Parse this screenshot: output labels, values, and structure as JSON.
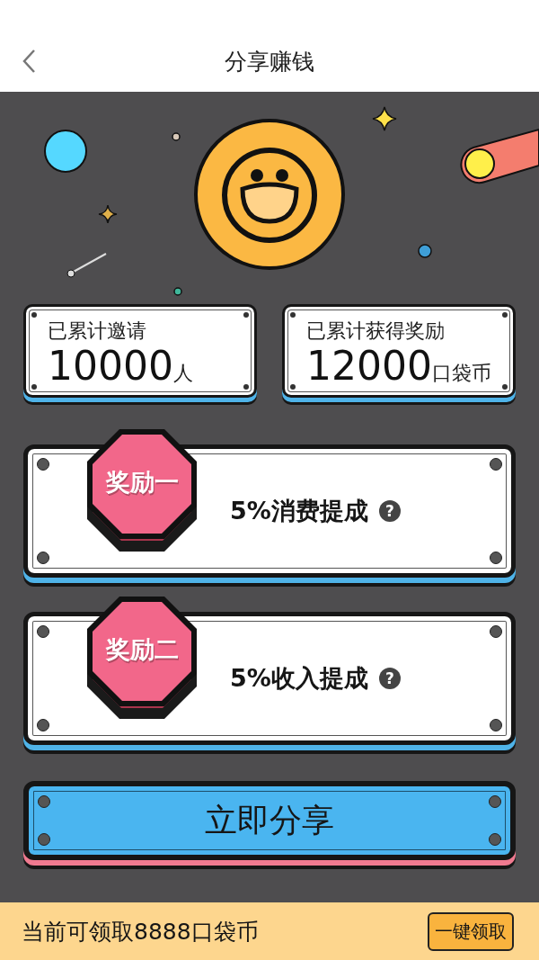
{
  "header": {
    "title": "分享赚钱"
  },
  "stats": [
    {
      "label": "已累计邀请",
      "value": "10000",
      "unit": "人"
    },
    {
      "label": "已累计获得奖励",
      "value": "12000",
      "unit": "口袋币"
    }
  ],
  "rewards": [
    {
      "badge": "奖励一",
      "text": "5%消费提成",
      "help": "?"
    },
    {
      "badge": "奖励二",
      "text": "5%收入提成",
      "help": "?"
    }
  ],
  "share_button": "立即分享",
  "bottom_bar": {
    "text": "当前可领取8888口袋币",
    "button": "一键领取"
  }
}
